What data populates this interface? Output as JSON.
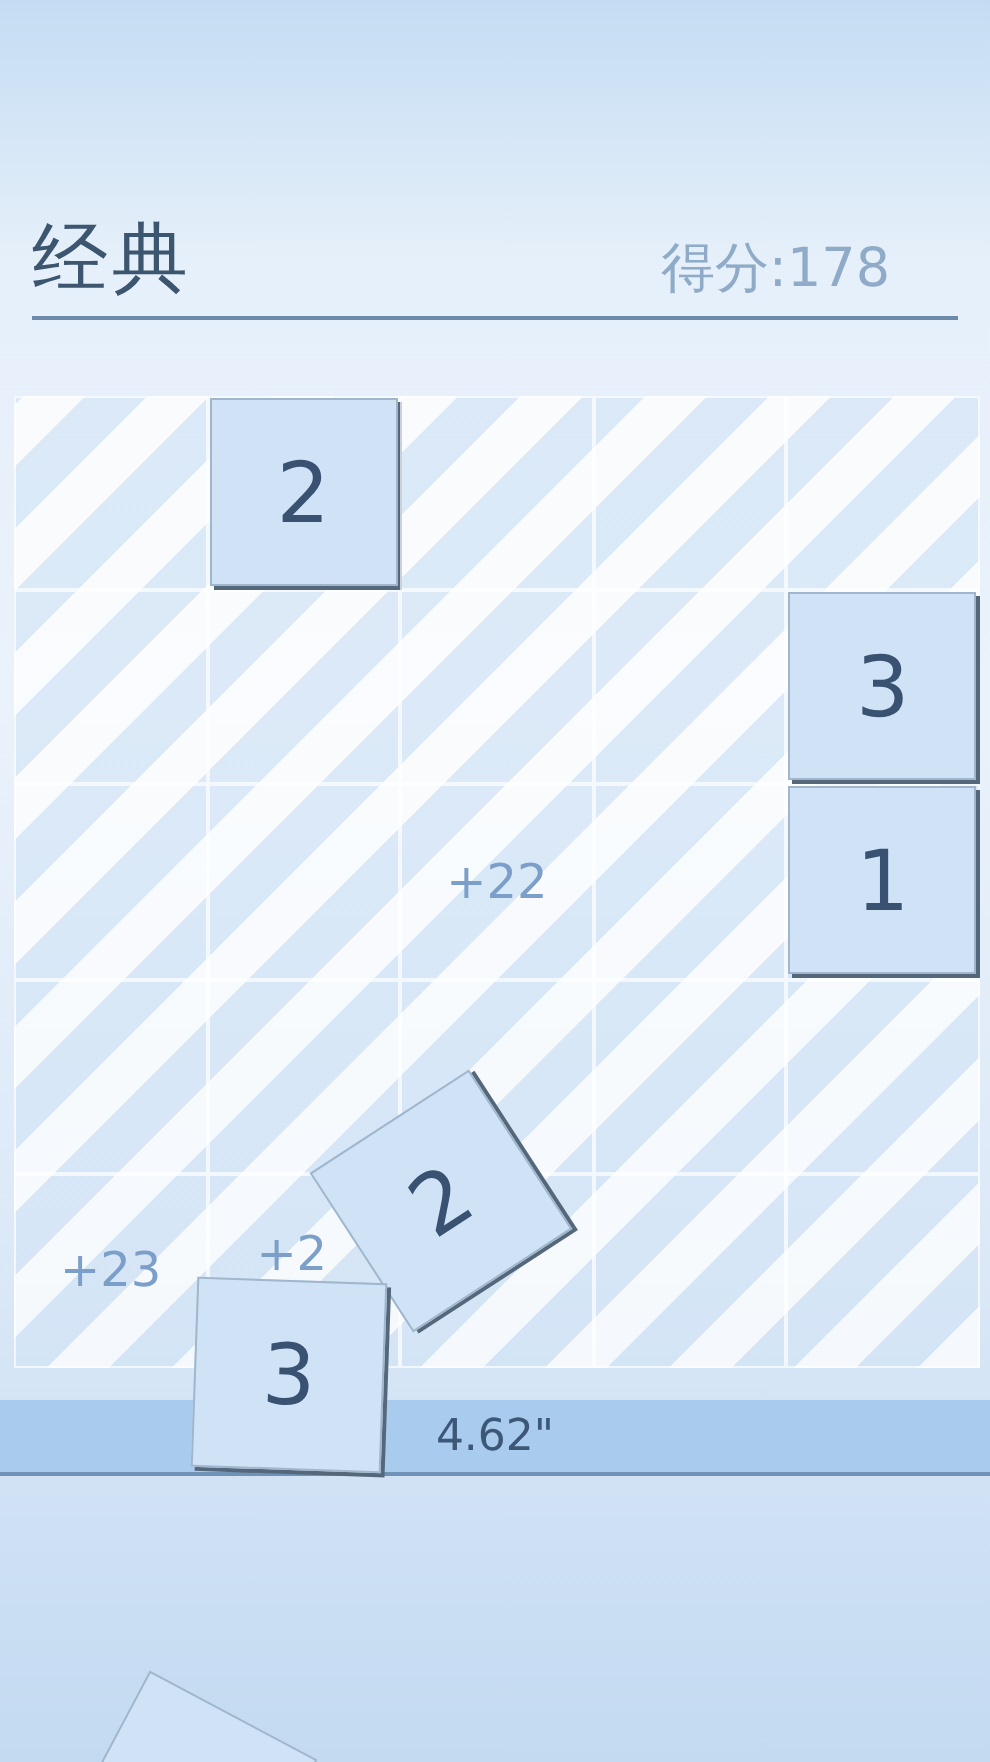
{
  "header": {
    "title": "经典",
    "score": "得分:178"
  },
  "board": {
    "rows": [
      [
        {
          "kind": "empty"
        },
        {
          "kind": "tile",
          "text": "2"
        },
        {
          "kind": "empty"
        },
        {
          "kind": "empty"
        },
        {
          "kind": "empty"
        }
      ],
      [
        {
          "kind": "empty"
        },
        {
          "kind": "empty"
        },
        {
          "kind": "empty"
        },
        {
          "kind": "empty"
        },
        {
          "kind": "tile",
          "text": "3"
        }
      ],
      [
        {
          "kind": "empty"
        },
        {
          "kind": "empty"
        },
        {
          "kind": "popup",
          "text": "+22"
        },
        {
          "kind": "empty"
        },
        {
          "kind": "tile",
          "text": "1"
        }
      ],
      [
        {
          "kind": "empty"
        },
        {
          "kind": "empty"
        },
        {
          "kind": "empty"
        },
        {
          "kind": "empty"
        },
        {
          "kind": "empty"
        }
      ],
      [
        {
          "kind": "popup",
          "text": "+23"
        },
        {
          "kind": "popup",
          "text": "+2"
        },
        {
          "kind": "empty"
        },
        {
          "kind": "empty"
        },
        {
          "kind": "empty"
        }
      ]
    ]
  },
  "falling_tiles": [
    {
      "kind": "numbered",
      "value": "2"
    },
    {
      "kind": "numbered",
      "value": "3"
    },
    {
      "kind": "blank"
    }
  ],
  "timer": {
    "text": "4.62\""
  }
}
